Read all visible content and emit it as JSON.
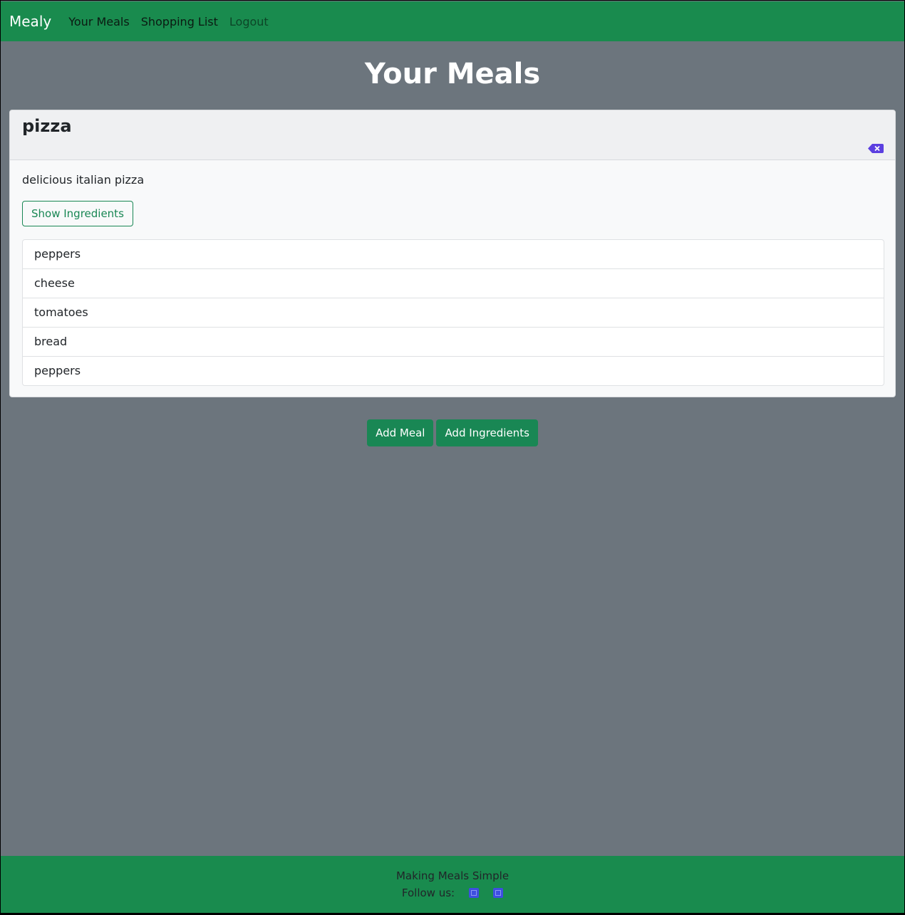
{
  "navbar": {
    "brand": "Mealy",
    "links": [
      {
        "label": "Your Meals"
      },
      {
        "label": "Shopping List"
      },
      {
        "label": "Logout"
      }
    ]
  },
  "page": {
    "title": "Your Meals"
  },
  "meal": {
    "name": "pizza",
    "description": "delicious italian pizza",
    "show_ingredients_label": "Show Ingredients",
    "delete_icon": "backspace-x-icon",
    "ingredients": [
      "peppers",
      "cheese",
      "tomatoes",
      "bread",
      "peppers"
    ]
  },
  "actions": {
    "add_meal_label": "Add Meal",
    "add_ingredients_label": "Add Ingredients"
  },
  "footer": {
    "tagline": "Making Meals Simple",
    "follow_label": "Follow us:",
    "social_icons": [
      "facebook-icon",
      "instagram-icon"
    ]
  },
  "colors": {
    "navbar_bg": "#198b4e",
    "page_bg": "#6c757d",
    "success": "#198754",
    "icon_accent": "#3d4ee0"
  }
}
